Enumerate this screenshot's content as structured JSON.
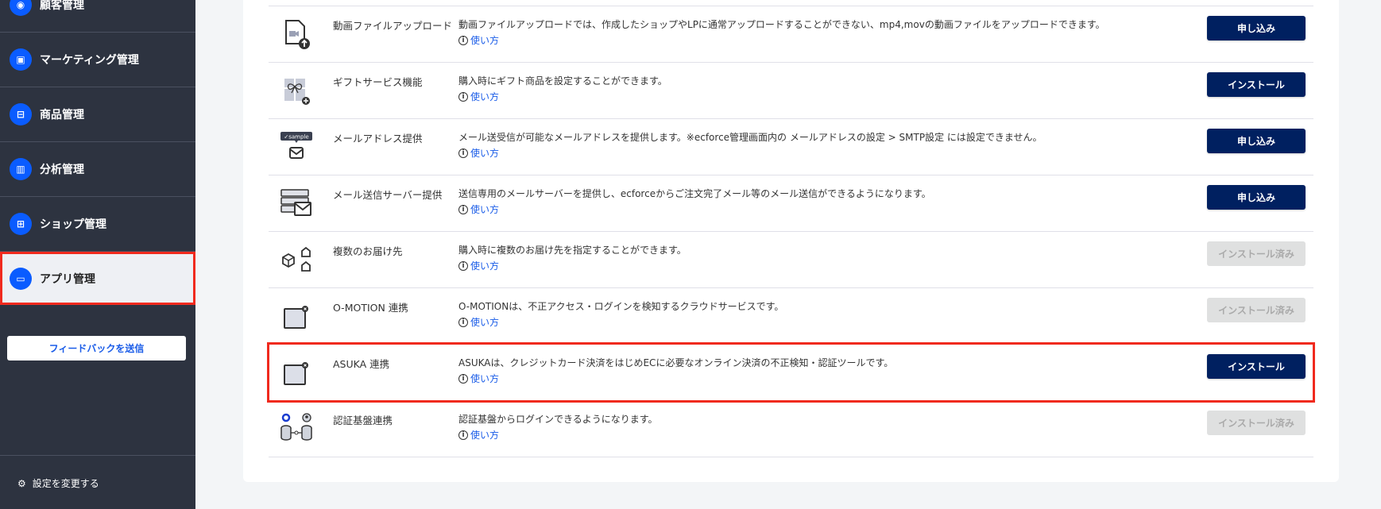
{
  "sidebar": {
    "items": [
      {
        "label": "顧客管理",
        "icon": "user-circle-icon"
      },
      {
        "label": "マーケティング管理",
        "icon": "ad-icon"
      },
      {
        "label": "商品管理",
        "icon": "bag-icon"
      },
      {
        "label": "分析管理",
        "icon": "chart-icon"
      },
      {
        "label": "ショップ管理",
        "icon": "store-icon"
      },
      {
        "label": "アプリ管理",
        "icon": "app-icon",
        "selected": true
      }
    ],
    "feedback_label": "フィードバックを送信",
    "settings_label": "設定を変更する"
  },
  "apps": [
    {
      "name": "動画ファイルアップロード",
      "desc": "動画ファイルアップロードでは、作成したショップやLPに通常アップロードすることができない、mp4,movの動画ファイルをアップロードできます。",
      "how": "使い方",
      "button": "申し込み",
      "status": "available",
      "icon": "video-upload-icon"
    },
    {
      "name": "ギフトサービス機能",
      "desc": "購入時にギフト商品を設定することができます。",
      "how": "使い方",
      "button": "インストール",
      "status": "available",
      "icon": "gift-icon"
    },
    {
      "name": "メールアドレス提供",
      "desc": "メール送受信が可能なメールアドレスを提供します。※ecforce管理画面内の メールアドレスの設定 > SMTP設定 には設定できません。",
      "how": "使い方",
      "button": "申し込み",
      "status": "available",
      "icon": "mail-sample-icon"
    },
    {
      "name": "メール送信サーバー提供",
      "desc": "送信専用のメールサーバーを提供し、ecforceからご注文完了メール等のメール送信ができるようになります。",
      "how": "使い方",
      "button": "申し込み",
      "status": "available",
      "icon": "mail-server-icon"
    },
    {
      "name": "複数のお届け先",
      "desc": "購入時に複数のお届け先を指定することができます。",
      "how": "使い方",
      "button": "インストール済み",
      "status": "installed",
      "icon": "multi-delivery-icon"
    },
    {
      "name": "O-MOTION 連携",
      "desc": "O-MOTIONは、不正アクセス・ログインを検知するクラウドサービスです。",
      "how": "使い方",
      "button": "インストール済み",
      "status": "installed",
      "icon": "app-placeholder-icon"
    },
    {
      "name": "ASUKA 連携",
      "desc": "ASUKAは、クレジットカード決済をはじめECに必要なオンライン決済の不正検知・認証ツールです。",
      "how": "使い方",
      "button": "インストール",
      "status": "available",
      "icon": "app-placeholder-icon",
      "highlighted": true
    },
    {
      "name": "認証基盤連携",
      "desc": "認証基盤からログインできるようになります。",
      "how": "使い方",
      "button": "インストール済み",
      "status": "installed",
      "icon": "auth-db-icon"
    }
  ],
  "colors": {
    "sidebar": "#2d3340",
    "accent": "#0a5cff",
    "button": "#002060",
    "highlight": "#f02a1e"
  }
}
